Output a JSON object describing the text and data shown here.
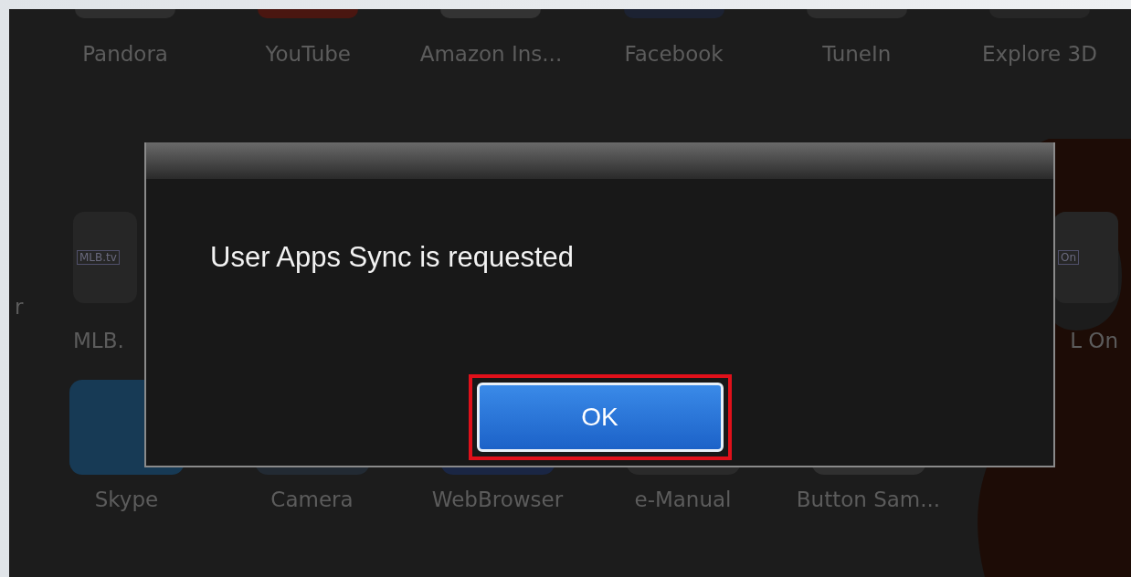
{
  "apps_top_row": [
    {
      "label": "Pandora",
      "color": "#2e2e2e"
    },
    {
      "label": "YouTube",
      "color": "#4a1610"
    },
    {
      "label": "Amazon Ins...",
      "color": "#333333"
    },
    {
      "label": "Facebook",
      "color": "#1c2232"
    },
    {
      "label": "TuneIn",
      "color": "#2c2c2c"
    },
    {
      "label": "Explore 3D",
      "color": "#262626"
    }
  ],
  "apps_middle_row": [
    {
      "kind": "edge",
      "label": "r"
    },
    {
      "kind": "tile",
      "label": "MLB.",
      "logo_text": "MLB.tv"
    },
    {
      "kind": "tile",
      "label": "L On",
      "logo_text": "On"
    }
  ],
  "apps_bottom_row": [
    {
      "label": "Skype",
      "color": "#173a55"
    },
    {
      "label": "Camera",
      "color": "#222a33"
    },
    {
      "label": "WebBrowser",
      "color": "#1a2644"
    },
    {
      "label": "e-Manual",
      "color": "#2a2a2a"
    },
    {
      "label": "Button Sam...",
      "color": "#303030"
    }
  ],
  "dialog": {
    "message": "User Apps Sync is requested",
    "buttons": [
      {
        "label": "OK",
        "selected": true
      }
    ]
  }
}
